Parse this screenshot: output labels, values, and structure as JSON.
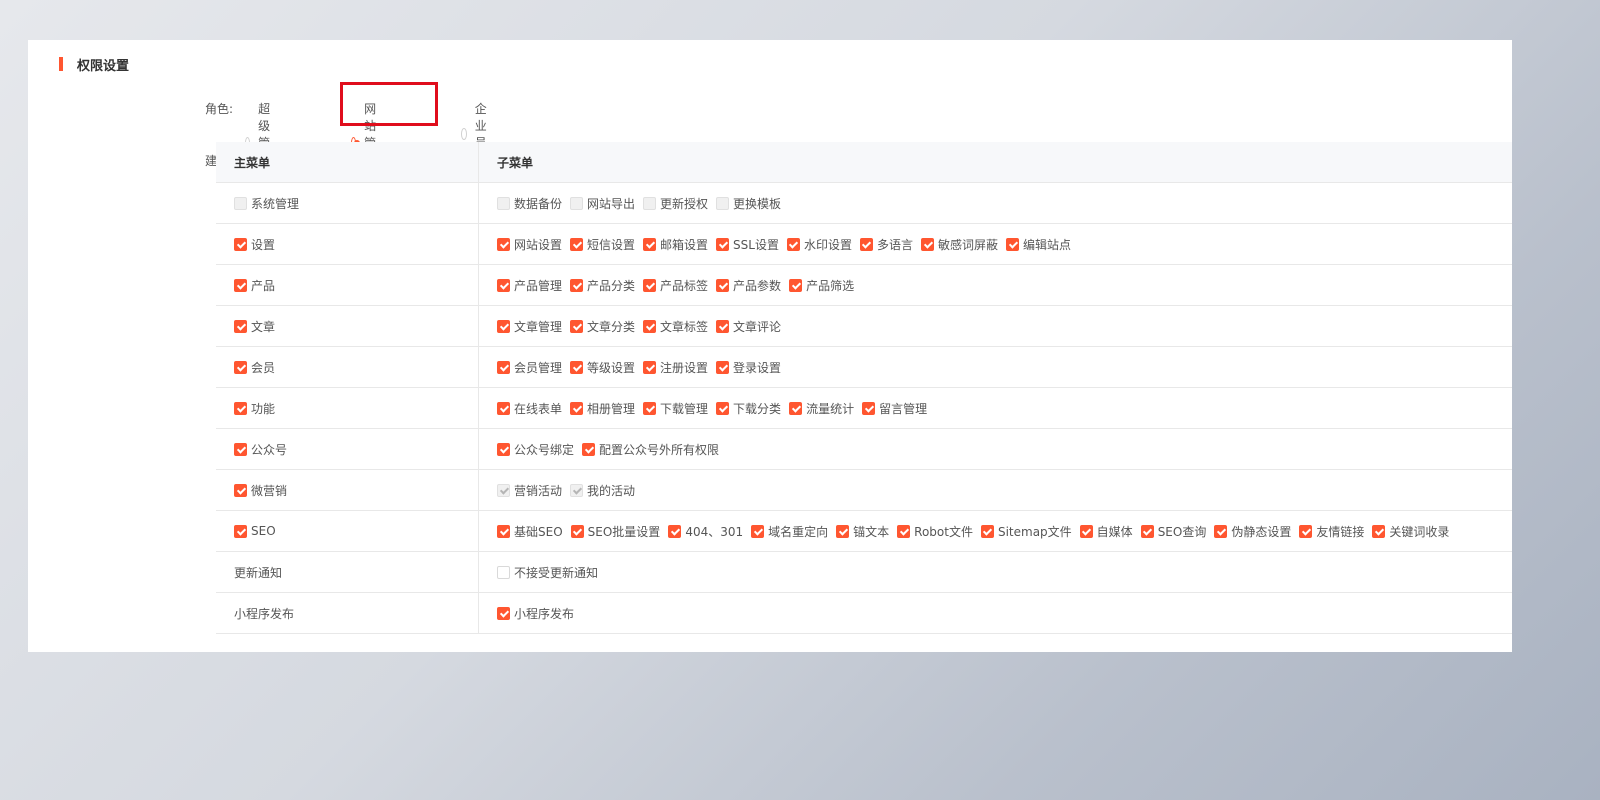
{
  "section": {
    "title": "权限设置"
  },
  "role": {
    "label": "角色:",
    "options": [
      {
        "label": "超级管理员",
        "checked": false
      },
      {
        "label": "网站管理员",
        "checked": true
      },
      {
        "label": "企业员工",
        "checked": false
      }
    ]
  },
  "build": {
    "label": "建站:"
  },
  "table": {
    "headers": {
      "main": "主菜单",
      "sub": "子菜单"
    },
    "rows": [
      {
        "main": {
          "label": "系统管理",
          "state": "disabled"
        },
        "subs": [
          {
            "label": "数据备份",
            "state": "disabled"
          },
          {
            "label": "网站导出",
            "state": "disabled"
          },
          {
            "label": "更新授权",
            "state": "disabled"
          },
          {
            "label": "更换模板",
            "state": "disabled"
          }
        ]
      },
      {
        "main": {
          "label": "设置",
          "state": "checked"
        },
        "subs": [
          {
            "label": "网站设置",
            "state": "checked"
          },
          {
            "label": "短信设置",
            "state": "checked"
          },
          {
            "label": "邮箱设置",
            "state": "checked"
          },
          {
            "label": "SSL设置",
            "state": "checked"
          },
          {
            "label": "水印设置",
            "state": "checked"
          },
          {
            "label": "多语言",
            "state": "checked"
          },
          {
            "label": "敏感词屏蔽",
            "state": "checked"
          },
          {
            "label": "编辑站点",
            "state": "checked"
          }
        ]
      },
      {
        "main": {
          "label": "产品",
          "state": "checked"
        },
        "subs": [
          {
            "label": "产品管理",
            "state": "checked"
          },
          {
            "label": "产品分类",
            "state": "checked"
          },
          {
            "label": "产品标签",
            "state": "checked"
          },
          {
            "label": "产品参数",
            "state": "checked"
          },
          {
            "label": "产品筛选",
            "state": "checked"
          }
        ]
      },
      {
        "main": {
          "label": "文章",
          "state": "checked"
        },
        "subs": [
          {
            "label": "文章管理",
            "state": "checked"
          },
          {
            "label": "文章分类",
            "state": "checked"
          },
          {
            "label": "文章标签",
            "state": "checked"
          },
          {
            "label": "文章评论",
            "state": "checked"
          }
        ]
      },
      {
        "main": {
          "label": "会员",
          "state": "checked"
        },
        "subs": [
          {
            "label": "会员管理",
            "state": "checked"
          },
          {
            "label": "等级设置",
            "state": "checked"
          },
          {
            "label": "注册设置",
            "state": "checked"
          },
          {
            "label": "登录设置",
            "state": "checked"
          }
        ]
      },
      {
        "main": {
          "label": "功能",
          "state": "checked"
        },
        "subs": [
          {
            "label": "在线表单",
            "state": "checked"
          },
          {
            "label": "相册管理",
            "state": "checked"
          },
          {
            "label": "下载管理",
            "state": "checked"
          },
          {
            "label": "下载分类",
            "state": "checked"
          },
          {
            "label": "流量统计",
            "state": "checked"
          },
          {
            "label": "留言管理",
            "state": "checked"
          }
        ]
      },
      {
        "main": {
          "label": "公众号",
          "state": "checked"
        },
        "subs": [
          {
            "label": "公众号绑定",
            "state": "checked"
          },
          {
            "label": "配置公众号外所有权限",
            "state": "checked"
          }
        ]
      },
      {
        "main": {
          "label": "微营销",
          "state": "checked"
        },
        "subs": [
          {
            "label": "营销活动",
            "state": "disabled-checked"
          },
          {
            "label": "我的活动",
            "state": "disabled-checked"
          }
        ]
      },
      {
        "main": {
          "label": "SEO",
          "state": "checked"
        },
        "subs": [
          {
            "label": "基础SEO",
            "state": "checked"
          },
          {
            "label": "SEO批量设置",
            "state": "checked"
          },
          {
            "label": "404、301",
            "state": "checked"
          },
          {
            "label": "域名重定向",
            "state": "checked"
          },
          {
            "label": "锚文本",
            "state": "checked"
          },
          {
            "label": "Robot文件",
            "state": "checked"
          },
          {
            "label": "Sitemap文件",
            "state": "checked"
          },
          {
            "label": "自媒体",
            "state": "checked"
          },
          {
            "label": "SEO查询",
            "state": "checked"
          },
          {
            "label": "伪静态设置",
            "state": "checked"
          },
          {
            "label": "友情链接",
            "state": "checked"
          },
          {
            "label": "关键词收录",
            "state": "checked"
          }
        ]
      },
      {
        "main": {
          "label": "更新通知",
          "state": "none"
        },
        "subs": [
          {
            "label": "不接受更新通知",
            "state": "unchecked"
          }
        ]
      },
      {
        "main": {
          "label": "小程序发布",
          "state": "none"
        },
        "subs": [
          {
            "label": "小程序发布",
            "state": "checked"
          }
        ]
      }
    ]
  },
  "colors": {
    "accent": "#ff5630",
    "highlight": "#e00d1c"
  }
}
